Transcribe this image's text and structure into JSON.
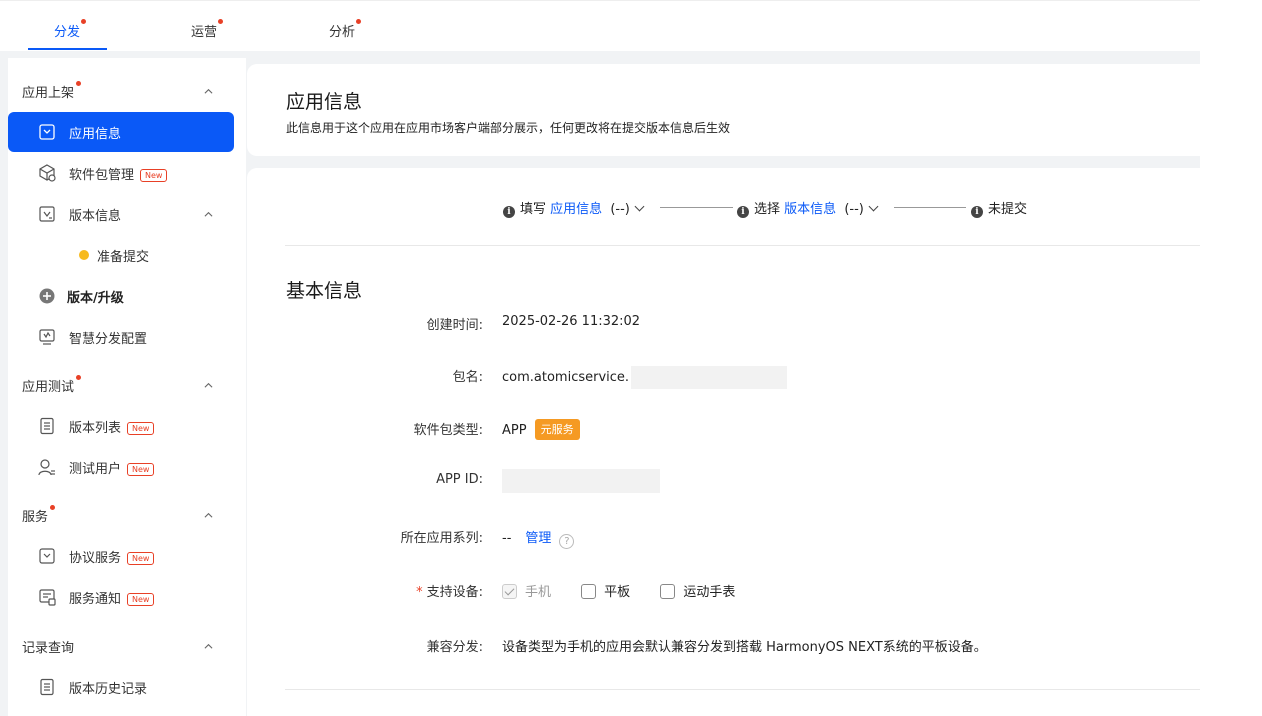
{
  "top_tabs": [
    {
      "label": "分发",
      "dot": true,
      "active": true
    },
    {
      "label": "运营",
      "dot": true,
      "active": false
    },
    {
      "label": "分析",
      "dot": true,
      "active": false
    }
  ],
  "sidebar": {
    "sections": [
      {
        "title": "应用上架",
        "dot": true,
        "expanded": true
      },
      {
        "title": "应用测试",
        "dot": true,
        "expanded": true
      },
      {
        "title": "服务",
        "dot": true,
        "expanded": true
      },
      {
        "title": "记录查询",
        "dot": false,
        "expanded": true
      }
    ],
    "items": [
      {
        "label": "应用信息",
        "icon": "app-info-icon",
        "active": true
      },
      {
        "label": "软件包管理",
        "icon": "package-icon",
        "badge": "New"
      },
      {
        "label": "版本信息",
        "icon": "version-info-icon",
        "expandable": true
      },
      {
        "label": "准备提交",
        "status": "yellow"
      },
      {
        "label": "版本/升级",
        "icon": "plus-circle-icon"
      },
      {
        "label": "智慧分发配置",
        "icon": "smart-distribution-icon"
      },
      {
        "label": "版本列表",
        "icon": "list-icon",
        "badge": "New"
      },
      {
        "label": "测试用户",
        "icon": "user-icon",
        "badge": "New"
      },
      {
        "label": "协议服务",
        "icon": "agreement-icon",
        "badge": "New"
      },
      {
        "label": "服务通知",
        "icon": "notification-icon",
        "badge": "New"
      },
      {
        "label": "版本历史记录",
        "icon": "history-icon"
      }
    ]
  },
  "header": {
    "title": "应用信息",
    "subtitle": "此信息用于这个应用在应用市场客户端部分展示，任何更改将在提交版本信息后生效"
  },
  "steps": [
    {
      "prefix": "填写",
      "link": "应用信息",
      "suffix": "(--)"
    },
    {
      "prefix": "选择",
      "link": "版本信息",
      "suffix": "(--)"
    },
    {
      "prefix": "未提交",
      "link": "",
      "suffix": ""
    }
  ],
  "basic": {
    "title": "基本信息",
    "created_label": "创建时间:",
    "created_value": "2025-02-26 11:32:02",
    "package_label": "包名:",
    "package_value": "com.atomicservice.",
    "type_label": "软件包类型:",
    "type_value": "APP",
    "type_tag": "元服务",
    "appid_label": "APP ID:",
    "series_label": "所在应用系列:",
    "series_value": "--",
    "series_link": "管理",
    "series_help": "?",
    "devices_required": "*",
    "devices_label": "支持设备:",
    "devices": [
      {
        "label": "手机",
        "checked": true,
        "disabled": true
      },
      {
        "label": "平板",
        "checked": false,
        "disabled": false
      },
      {
        "label": "运动手表",
        "checked": false,
        "disabled": false
      }
    ],
    "compat_label": "兼容分发:",
    "compat_value": "设备类型为手机的应用会默认兼容分发到搭载 HarmonyOS NEXT系统的平板设备。"
  },
  "colors": {
    "accent": "#0a59f7",
    "dot": "#e84026",
    "tag": "#f59a23",
    "status_yellow": "#f7ba1e"
  }
}
